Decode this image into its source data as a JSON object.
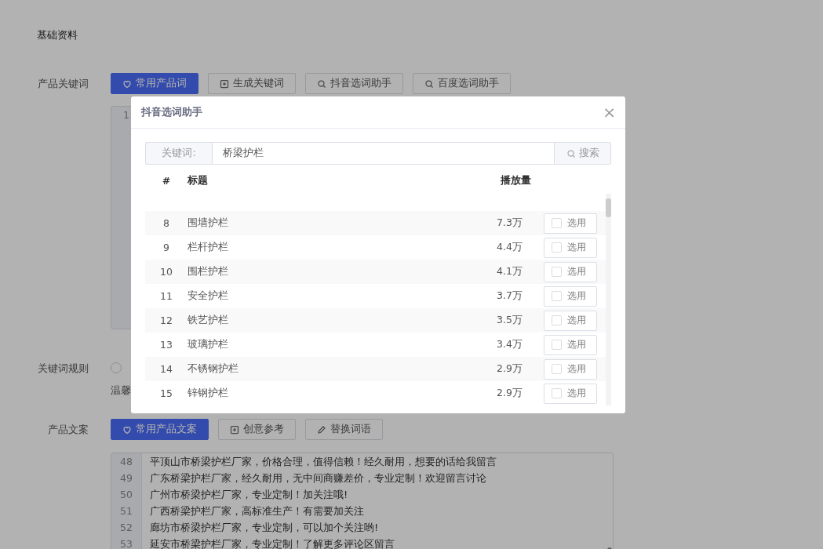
{
  "section_title": "基础资料",
  "keywords": {
    "label": "产品关键词",
    "buttons": [
      {
        "kind": "primary",
        "label": "常用产品词"
      },
      {
        "kind": "default",
        "label": "生成关键词"
      },
      {
        "kind": "default",
        "label": "抖音选词助手"
      },
      {
        "kind": "default",
        "label": "百度选词助手"
      }
    ],
    "editor_lines": [
      {
        "number": "1"
      }
    ]
  },
  "rule": {
    "label": "关键词规则",
    "options": [
      {
        "selected": false
      }
    ],
    "tip": "温馨"
  },
  "copy": {
    "label": "产品文案",
    "buttons": [
      {
        "kind": "primary",
        "label": "常用产品文案"
      },
      {
        "kind": "default",
        "label": "创意参考"
      },
      {
        "kind": "default",
        "label": "替换词语"
      }
    ],
    "editor_lines": [
      {
        "number": "48",
        "text": "平顶山市桥梁护栏厂家，价格合理，值得信赖！经久耐用，想要的话给我留言"
      },
      {
        "number": "49",
        "text": "广东桥梁护栏厂家，经久耐用，无中间商赚差价，专业定制！欢迎留言讨论"
      },
      {
        "number": "50",
        "text": "广州市桥梁护栏厂家，专业定制！加关注哦!"
      },
      {
        "number": "51",
        "text": "广西桥梁护栏厂家，高标准生产！有需要加关注"
      },
      {
        "number": "52",
        "text": "廊坊市桥梁护栏厂家，专业定制，可以加个关注哟!"
      },
      {
        "number": "53",
        "text": "延安市桥梁护栏厂家，专业定制！了解更多评论区留言"
      }
    ]
  },
  "modal": {
    "title": "抖音选词助手",
    "close": "×",
    "search": {
      "label": "关键词:",
      "value": "桥梁护栏",
      "button": "搜索"
    },
    "columns": [
      "#",
      "标题",
      "播放量"
    ],
    "rows": [
      {
        "index": "8",
        "title": "围墙护栏",
        "plays": "7.3万",
        "action": "选用",
        "checked": false
      },
      {
        "index": "9",
        "title": "栏杆护栏",
        "plays": "4.4万",
        "action": "选用",
        "checked": false
      },
      {
        "index": "10",
        "title": "围栏护栏",
        "plays": "4.1万",
        "action": "选用",
        "checked": false
      },
      {
        "index": "11",
        "title": "安全护栏",
        "plays": "3.7万",
        "action": "选用",
        "checked": false
      },
      {
        "index": "12",
        "title": "铁艺护栏",
        "plays": "3.5万",
        "action": "选用",
        "checked": false
      },
      {
        "index": "13",
        "title": "玻璃护栏",
        "plays": "3.4万",
        "action": "选用",
        "checked": false
      },
      {
        "index": "14",
        "title": "不锈钢护栏",
        "plays": "2.9万",
        "action": "选用",
        "checked": false
      },
      {
        "index": "15",
        "title": "锌钢护栏",
        "plays": "2.9万",
        "action": "选用",
        "checked": false
      }
    ]
  }
}
